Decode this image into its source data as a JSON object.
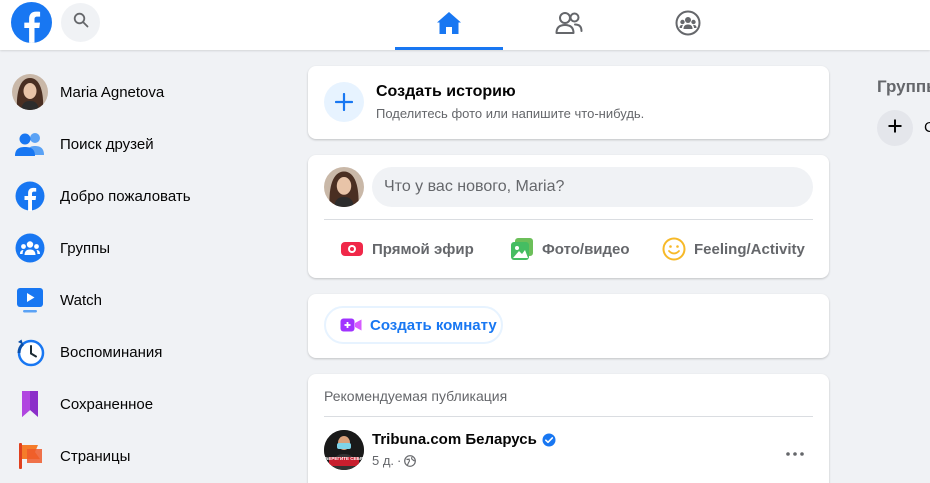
{
  "topbar": {
    "logo_icon": "facebook-logo-icon",
    "search_icon": "search-icon",
    "tabs": [
      {
        "name": "home",
        "icon": "home-icon",
        "active": true
      },
      {
        "name": "friends",
        "icon": "friends-icon",
        "active": false
      },
      {
        "name": "groups",
        "icon": "groups-icon",
        "active": false
      }
    ]
  },
  "sidebar": {
    "items": [
      {
        "label": "Maria Agnetova",
        "icon": "avatar"
      },
      {
        "label": "Поиск друзей",
        "icon": "friends-icon"
      },
      {
        "label": "Добро пожаловать",
        "icon": "facebook-icon"
      },
      {
        "label": "Группы",
        "icon": "groups-icon"
      },
      {
        "label": "Watch",
        "icon": "watch-icon"
      },
      {
        "label": "Воспоминания",
        "icon": "memories-clock-icon"
      },
      {
        "label": "Сохраненное",
        "icon": "bookmark-icon"
      },
      {
        "label": "Страницы",
        "icon": "pages-flag-icon"
      }
    ]
  },
  "story": {
    "title": "Создать историю",
    "subtitle": "Поделитесь фото или напишите что-нибудь."
  },
  "composer": {
    "placeholder": "Что у вас нового, Maria?",
    "actions": {
      "live": "Прямой эфир",
      "photo": "Фото/видео",
      "feeling": "Feeling/Activity"
    }
  },
  "room": {
    "label": "Создать комнату"
  },
  "post": {
    "recommended": "Рекомендуемая публикация",
    "author": "Tribuna.com Беларусь",
    "time": "5 д.",
    "separator": "·",
    "avatar_text": "БЕРЕГИТЕ СЕБЯ"
  },
  "right": {
    "title": "Группы",
    "create_label": "С"
  },
  "colors": {
    "brand": "#1877f2",
    "background": "#f0f2f5",
    "secondary_text": "#65676b"
  }
}
